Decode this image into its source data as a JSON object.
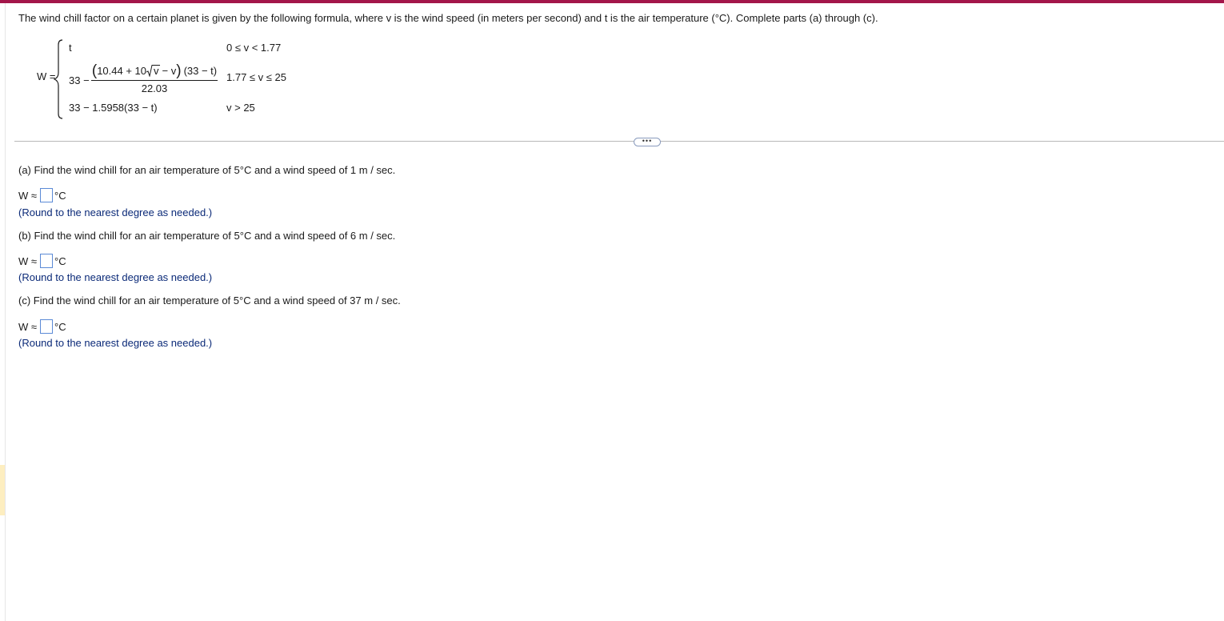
{
  "problem": {
    "intro": "The wind chill factor on a certain planet is given by the following formula, where v is the wind speed (in meters per second) and t is the air temperature (°C). Complete parts (a) through (c)."
  },
  "formula": {
    "lhs": "W =",
    "case1": {
      "expr": "t",
      "cond": "0 ≤ v < 1.77"
    },
    "case2": {
      "prefix": "33 −",
      "num_a": "10.44 + 10",
      "num_root": "v",
      "num_b": "− v",
      "num_c": "(33 − t)",
      "den": "22.03",
      "cond": "1.77 ≤ v ≤ 25"
    },
    "case3": {
      "expr": "33 − 1.5958(33 − t)",
      "cond": "v > 25"
    }
  },
  "more_button": {
    "label": "•••"
  },
  "parts": [
    {
      "question": "(a) Find the wind chill for an air temperature of 5°C and a wind speed of 1 m / sec.",
      "answer_prefix": "W ≈",
      "answer_value": "",
      "unit": "°C",
      "hint": "(Round to the nearest degree as needed.)"
    },
    {
      "question": "(b) Find the wind chill for an air temperature of 5°C and a wind speed of 6 m / sec.",
      "answer_prefix": "W ≈",
      "answer_value": "",
      "unit": "°C",
      "hint": "(Round to the nearest degree as needed.)"
    },
    {
      "question": "(c)  Find the wind chill for an air temperature of 5°C and a wind speed of 37 m / sec.",
      "answer_prefix": "W ≈",
      "answer_value": "",
      "unit": "°C",
      "hint": "(Round to the nearest degree as needed.)"
    }
  ],
  "colors": {
    "top_bar": "#a3164a",
    "input_border": "#5b8ad6",
    "hint_text": "#0b2a78"
  }
}
